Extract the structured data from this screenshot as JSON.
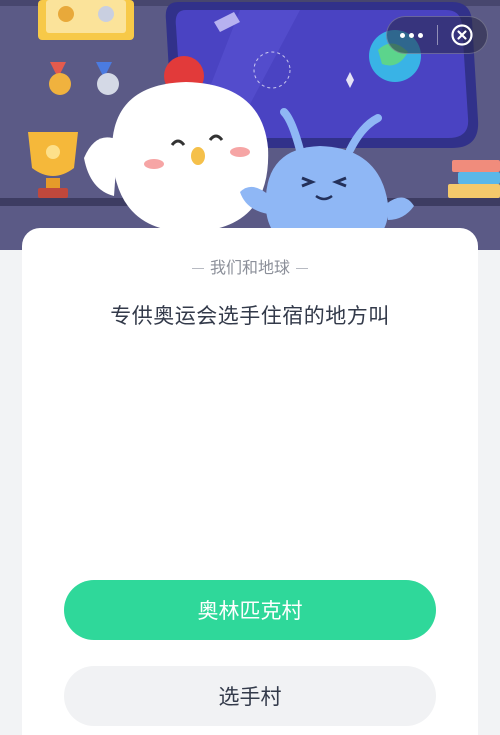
{
  "quiz": {
    "section_title": "我们和地球",
    "question": "专供奥运会选手住宿的地方叫",
    "options": [
      {
        "label": "奥林匹克村"
      },
      {
        "label": "选手村"
      }
    ]
  },
  "capsule": {
    "more_icon": "more-dots-icon",
    "close_icon": "close-circle-icon"
  },
  "colors": {
    "primary_option": "#2fd89a",
    "secondary_option": "#f1f2f4",
    "hero_background": "#5b5a86"
  }
}
